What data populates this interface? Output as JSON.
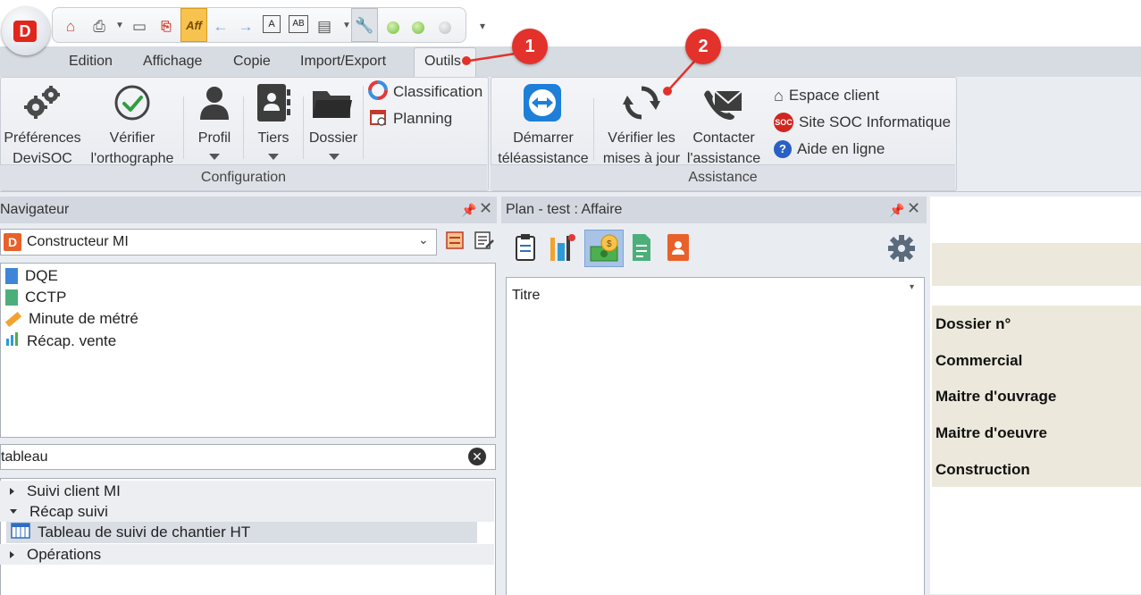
{
  "ribbon_tabs": [
    "Edition",
    "Affichage",
    "Copie",
    "Import/Export",
    "Outils"
  ],
  "configuration_group": {
    "label": "Configuration",
    "preferences": [
      "Préférences",
      "DeviSOC"
    ],
    "spelling": [
      "Vérifier",
      "l'orthographe"
    ],
    "profil": "Profil",
    "tiers": "Tiers",
    "dossier": "Dossier",
    "classification": "Classification",
    "planning": "Planning"
  },
  "assistance_group": {
    "label": "Assistance",
    "remote": [
      "Démarrer",
      "téléassistance"
    ],
    "updates": [
      "Vérifier les",
      "mises à jour"
    ],
    "contact": [
      "Contacter",
      "l'assistance"
    ],
    "espace_client": "Espace client",
    "site_soc": "Site SOC Informatique",
    "aide": "Aide en ligne"
  },
  "navigator": {
    "title": "Navigateur",
    "profile_select": "Constructeur MI",
    "items": [
      "DQE",
      "CCTP",
      "Minute de métré",
      "Récap. vente"
    ],
    "search_value": "tableau",
    "tree": [
      "Suivi client MI",
      "Récap suivi",
      "Tableau de suivi de chantier HT",
      "Opérations"
    ]
  },
  "plan": {
    "title": "Plan - test : Affaire",
    "column": "Titre"
  },
  "right_panel": {
    "fields": [
      "Dossier n°",
      "Commercial",
      "Maitre d'ouvrage",
      "Maitre d'oeuvre",
      "Construction"
    ]
  },
  "callouts": [
    "1",
    "2"
  ],
  "colors": {
    "callout": "#e3322b",
    "ribbon_bg": "#e9ecf1",
    "field_bg": "#ece9dc",
    "selection": "#d9dde4"
  },
  "icons": {
    "app": "devisoc-logo",
    "qat": [
      "home-icon",
      "printer-icon",
      "print-preview-icon",
      "pdf-icon",
      "aff-icon",
      "back-arrow-icon",
      "forward-arrow-icon",
      "frame-icon",
      "frame-ab-icon",
      "window-icon",
      "wrench-icon",
      "green-dot-icon",
      "green-dot-icon",
      "grey-dot-icon"
    ]
  }
}
